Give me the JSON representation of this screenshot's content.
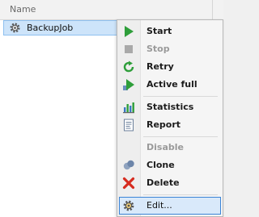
{
  "grid": {
    "column_name": "Name",
    "rows": [
      {
        "label": "BackupJob",
        "icon": "gear-icon",
        "selected": true
      }
    ]
  },
  "context_menu": {
    "items": [
      {
        "label": "Start",
        "icon": "play-icon",
        "enabled": true
      },
      {
        "label": "Stop",
        "icon": "stop-icon",
        "enabled": false
      },
      {
        "label": "Retry",
        "icon": "retry-icon",
        "enabled": true
      },
      {
        "label": "Active full",
        "icon": "active-full-icon",
        "enabled": true
      },
      {
        "label": "Statistics",
        "icon": "statistics-icon",
        "enabled": true
      },
      {
        "label": "Report",
        "icon": "report-icon",
        "enabled": true
      },
      {
        "label": "Disable",
        "icon": "",
        "enabled": false
      },
      {
        "label": "Clone",
        "icon": "clone-icon",
        "enabled": true
      },
      {
        "label": "Delete",
        "icon": "delete-icon",
        "enabled": true
      },
      {
        "label": "Edit...",
        "icon": "gear-icon",
        "enabled": true,
        "highlighted": true
      }
    ]
  },
  "colors": {
    "selection": "#cde4fa",
    "highlight_border": "#3b84d6",
    "start_green": "#2e9e3a",
    "delete_red": "#d62b1f"
  }
}
